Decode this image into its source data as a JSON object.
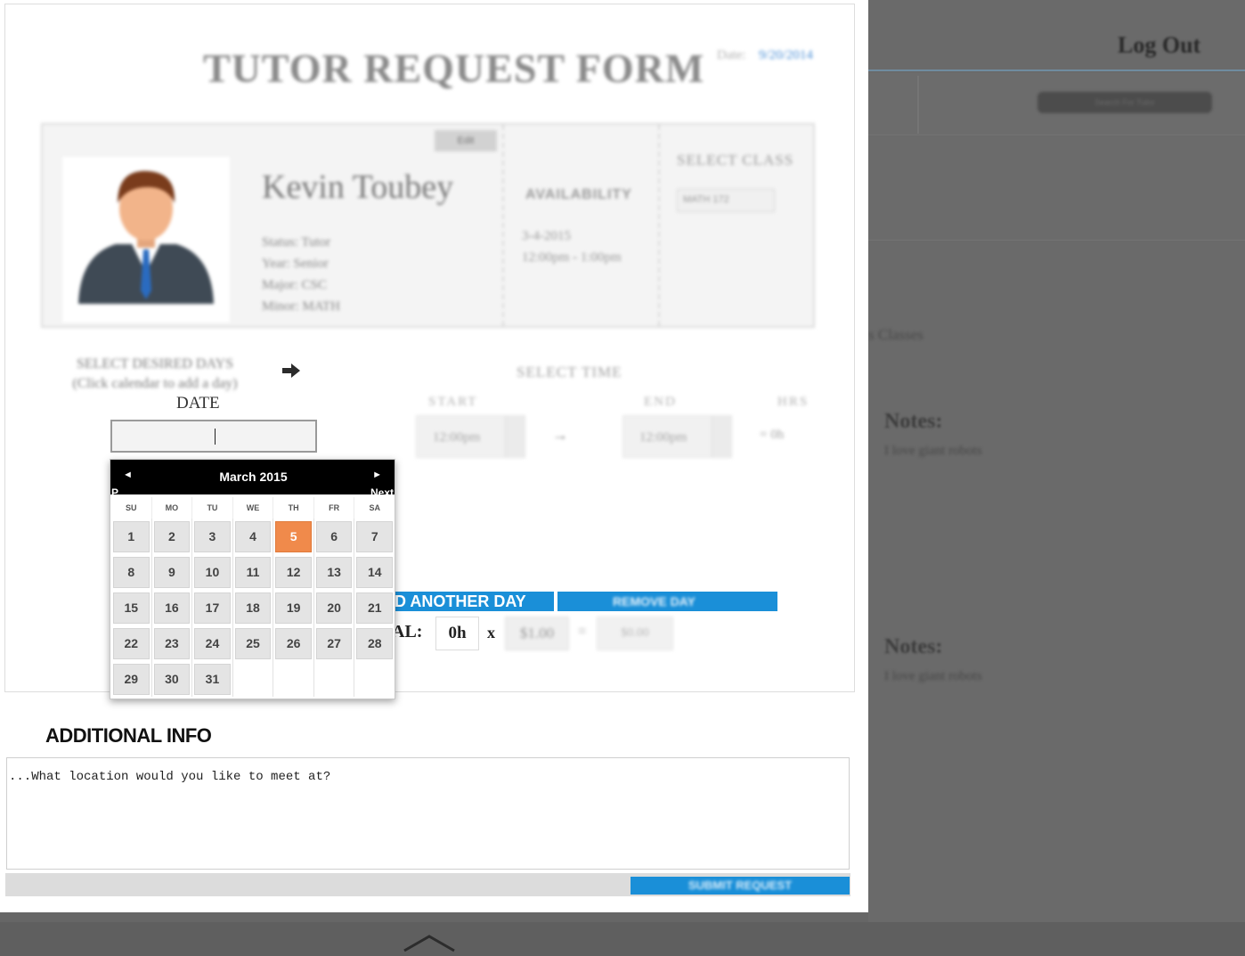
{
  "background": {
    "logout_label": "Log Out",
    "search_placeholder": "Search For Tutor",
    "classes_label": "s Classes",
    "notes": [
      {
        "title": "Notes:",
        "text": "I love giant robots"
      },
      {
        "title": "Notes:",
        "text": "I love giant robots"
      }
    ]
  },
  "form": {
    "title": "TUTOR REQUEST FORM",
    "date_label": "Date:",
    "date_value": "9/20/2014",
    "edit_label": "Edit",
    "tutor": {
      "name": "Kevin Toubey",
      "status": "Status: Tutor",
      "year": "Year: Senior",
      "major": "Major: CSC",
      "minor": "Minor: MATH"
    },
    "availability": {
      "title": "AVAILABILITY",
      "date": "3-4-2015",
      "time": "12:00pm - 1:00pm"
    },
    "select_class": {
      "title": "SELECT CLASS",
      "value": "MATH 172"
    },
    "days": {
      "title": "SELECT DESIRED DAYS",
      "subtitle": "(Click calendar to add a day)",
      "arrow_icon": "arrow-right-icon",
      "date_heading": "DATE",
      "date_value": ""
    },
    "time": {
      "title": "SELECT TIME",
      "start_label": "START",
      "end_label": "END",
      "hrs_label": "HRS",
      "start_value": "12:00pm",
      "end_value": "12:00pm",
      "arrow": "→",
      "hrs_value": "= 0h"
    },
    "add_day_label": "D ANOTHER DAY",
    "remove_day_label": "REMOVE DAY",
    "total": {
      "label": "AL:",
      "hours": "0h",
      "times": "x",
      "rate": "$1.00",
      "equals": "=",
      "sum": "$0.00"
    }
  },
  "calendar": {
    "prev_icon": "◄",
    "next_icon": "►",
    "prev_label": "P",
    "next_label": "Next",
    "month_title": "March 2015",
    "weekdays": [
      "SU",
      "MO",
      "TU",
      "WE",
      "TH",
      "FR",
      "SA"
    ],
    "highlighted_day": "5",
    "highlight_color": "#f08a4b",
    "weeks": [
      [
        "1",
        "2",
        "3",
        "4",
        "5",
        "6",
        "7"
      ],
      [
        "8",
        "9",
        "10",
        "11",
        "12",
        "13",
        "14"
      ],
      [
        "15",
        "16",
        "17",
        "18",
        "19",
        "20",
        "21"
      ],
      [
        "22",
        "23",
        "24",
        "25",
        "26",
        "27",
        "28"
      ],
      [
        "29",
        "30",
        "31",
        "",
        "",
        "",
        ""
      ]
    ]
  },
  "additional_info": {
    "heading": "ADDITIONAL INFO",
    "placeholder": "...What location would you like to meet at?",
    "submit_label": "SUBMIT REQUEST"
  },
  "footer": {
    "chevron_icon": "chevron-up-icon"
  },
  "colors": {
    "accent_blue": "#1a8fd8",
    "calendar_header": "#000000",
    "overlay": "#666666"
  }
}
